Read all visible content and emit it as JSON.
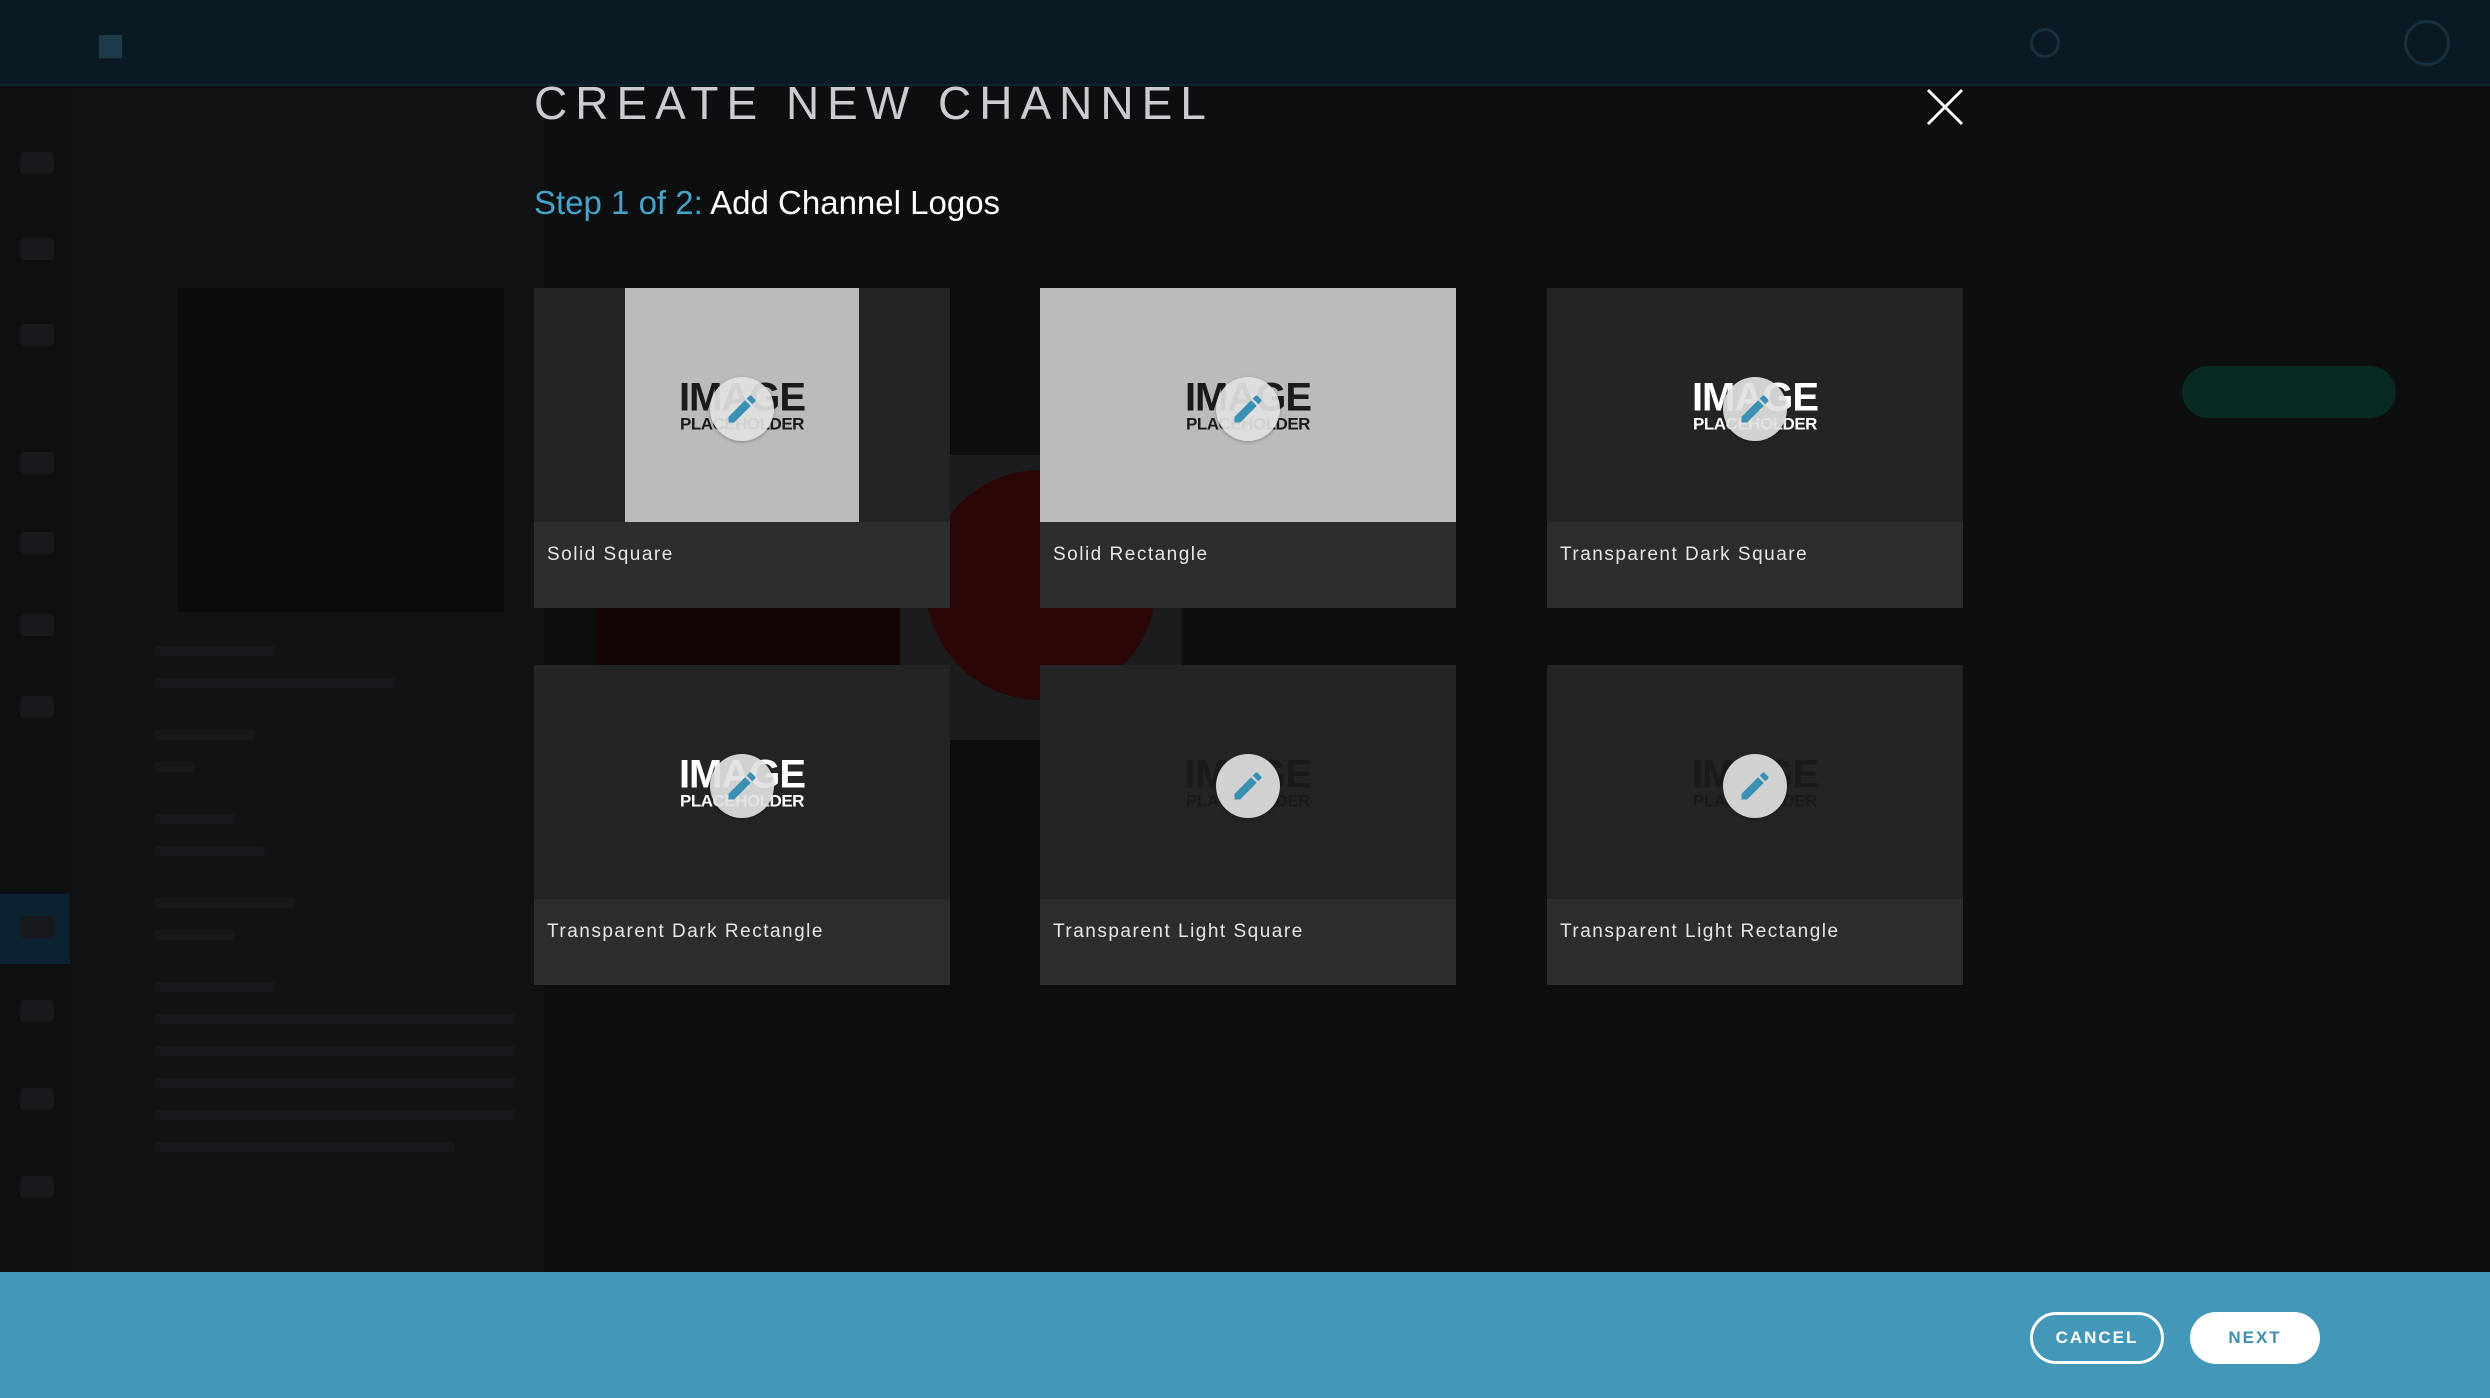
{
  "modal": {
    "title": "CREATE NEW CHANNEL",
    "step_prefix": "Step 1 of 2:",
    "step_title": "Add Channel Logos",
    "close_icon": "close-icon"
  },
  "logo_slots": [
    {
      "label": "Solid Square",
      "background": "solid-square",
      "placeholder_line1": "IMAGE",
      "placeholder_line2": "PLACEHOLDER"
    },
    {
      "label": "Solid Rectangle",
      "background": "solid-rectangle",
      "placeholder_line1": "IMAGE",
      "placeholder_line2": "PLACEHOLDER"
    },
    {
      "label": "Transparent Dark Square",
      "background": "transparent-dark",
      "placeholder_line1": "IMAGE",
      "placeholder_line2": "PLACEHOLDER"
    },
    {
      "label": "Transparent Dark Rectangle",
      "background": "transparent-dark",
      "placeholder_line1": "IMAGE",
      "placeholder_line2": "PLACEHOLDER"
    },
    {
      "label": "Transparent Light Square",
      "background": "transparent-light",
      "placeholder_line1": "IMAGE",
      "placeholder_line2": "PLACEHOLDER"
    },
    {
      "label": "Transparent Light Rectangle",
      "background": "transparent-light",
      "placeholder_line1": "IMAGE",
      "placeholder_line2": "PLACEHOLDER"
    }
  ],
  "footer": {
    "cancel_label": "CANCEL",
    "next_label": "NEXT"
  },
  "colors": {
    "accent": "#45a4c8",
    "footer": "#4397b8",
    "card": "#2c2d2f",
    "thumb_dark": "#232426",
    "thumb_solid": "#bbbbbb"
  }
}
